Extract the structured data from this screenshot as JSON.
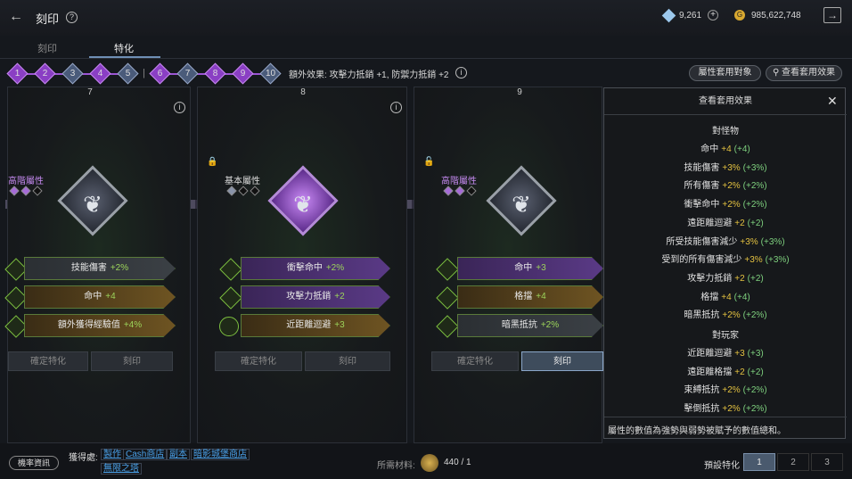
{
  "header": {
    "title": "刻印",
    "gems": "9,261",
    "gold": "985,622,748"
  },
  "tabs": [
    "刻印",
    "特化"
  ],
  "progress": {
    "nodes": [
      "1",
      "2",
      "3",
      "4",
      "5",
      "6",
      "7",
      "8",
      "9",
      "10"
    ],
    "extra_effect": "額外效果: 攻擊力抵銷 +1, 防禦力抵銷 +2"
  },
  "actions": {
    "apply_target": "屬性套用對象",
    "view_effects": "查看套用效果"
  },
  "cards": [
    {
      "num": "7",
      "attr_label": "高階屬性",
      "stats": [
        {
          "name": "技能傷害",
          "val": "+2%"
        },
        {
          "name": "命中",
          "val": "+4"
        },
        {
          "name": "額外獲得經驗值",
          "val": "+4%"
        }
      ],
      "btn_confirm": "確定特化",
      "btn_engrave": "刻印"
    },
    {
      "num": "8",
      "attr_label": "基本屬性",
      "stats": [
        {
          "name": "衝擊命中",
          "val": "+2%"
        },
        {
          "name": "攻擊力抵銷",
          "val": "+2"
        },
        {
          "name": "近距離迴避",
          "val": "+3"
        }
      ],
      "btn_confirm": "確定特化",
      "btn_engrave": "刻印"
    },
    {
      "num": "9",
      "attr_label": "高階屬性",
      "stats": [
        {
          "name": "命中",
          "val": "+3"
        },
        {
          "name": "格擋",
          "val": "+4"
        },
        {
          "name": "暗黑抵抗",
          "val": "+2%"
        }
      ],
      "btn_confirm": "確定特化",
      "btn_engrave": "刻印"
    }
  ],
  "panel": {
    "title": "查看套用效果",
    "section1": "對怪物",
    "rows1": [
      {
        "name": "命中",
        "val": "+4",
        "paren": "(+4)"
      },
      {
        "name": "技能傷害",
        "val": "+3%",
        "paren": "(+3%)"
      },
      {
        "name": "所有傷害",
        "val": "+2%",
        "paren": "(+2%)"
      },
      {
        "name": "衝擊命中",
        "val": "+2%",
        "paren": "(+2%)"
      },
      {
        "name": "遠距離迴避",
        "val": "+2",
        "paren": "(+2)"
      },
      {
        "name": "所受技能傷害減少",
        "val": "+3%",
        "paren": "(+3%)"
      },
      {
        "name": "受到的所有傷害減少",
        "val": "+3%",
        "paren": "(+3%)"
      },
      {
        "name": "攻擊力抵銷",
        "val": "+2",
        "paren": "(+2)"
      },
      {
        "name": "格擋",
        "val": "+4",
        "paren": "(+4)"
      },
      {
        "name": "暗黑抵抗",
        "val": "+2%",
        "paren": "(+2%)"
      }
    ],
    "section2": "對玩家",
    "rows2": [
      {
        "name": "近距離迴避",
        "val": "+3",
        "paren": "(+3)"
      },
      {
        "name": "遠距離格擋",
        "val": "+2",
        "paren": "(+2)"
      },
      {
        "name": "束縛抵抗",
        "val": "+2%",
        "paren": "(+2%)"
      },
      {
        "name": "擊倒抵抗",
        "val": "+2%",
        "paren": "(+2%)"
      }
    ],
    "footer": "屬性的數值為強勢與弱勢被賦予的數值總和。"
  },
  "bottom": {
    "odds": "機率資訊",
    "obtain": "獲得處:",
    "links": [
      "製作",
      "Cash商店",
      "副本",
      "暗影城堡商店",
      "無限之塔"
    ],
    "material_label": "所需材料:",
    "material_val": "440 / 1",
    "preset_label": "預設特化",
    "pages": [
      "1",
      "2",
      "3"
    ]
  }
}
